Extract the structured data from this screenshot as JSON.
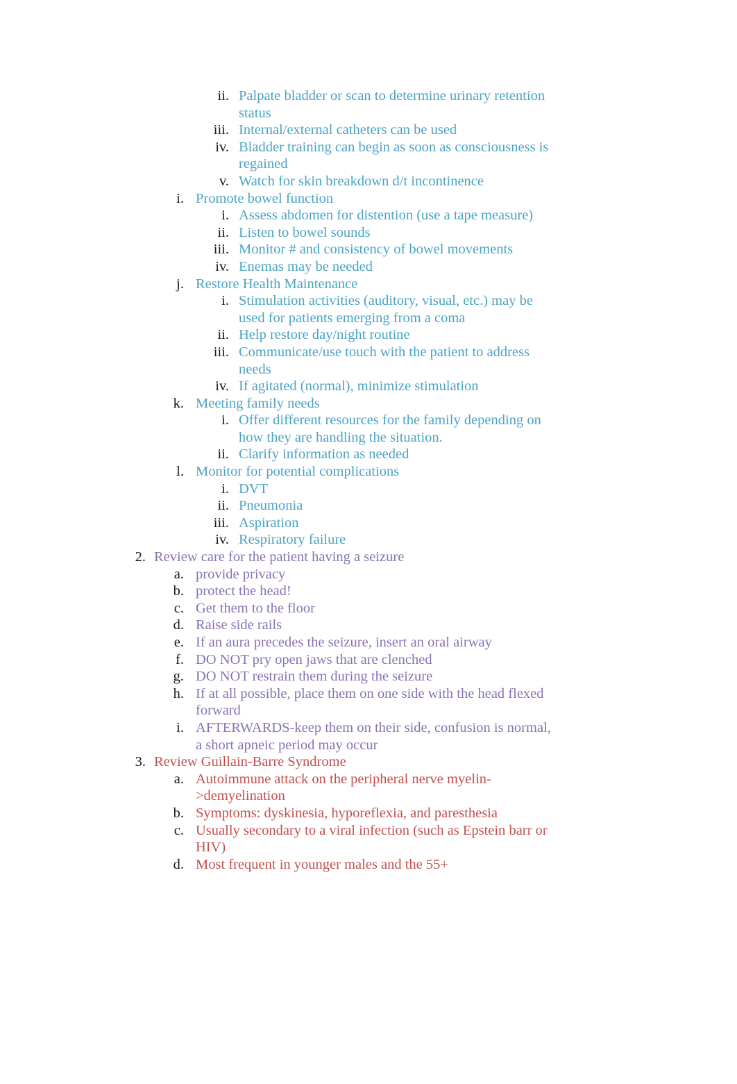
{
  "document": {
    "background_color": "#ffffff",
    "marker_color": "#1a1a1a",
    "colors": {
      "teal": "#4BA3C3",
      "purple": "#8A72B2",
      "red": "#C2504E"
    },
    "outline": [
      {
        "level": 3,
        "marker": "ii.",
        "color": "teal",
        "text": "Palpate bladder or scan to determine urinary retention status"
      },
      {
        "level": 3,
        "marker": "iii.",
        "color": "teal",
        "text": "Internal/external catheters can be used"
      },
      {
        "level": 3,
        "marker": "iv.",
        "color": "teal",
        "text": "Bladder training can begin as soon as consciousness is regained"
      },
      {
        "level": 3,
        "marker": "v.",
        "color": "teal",
        "text": "Watch for skin breakdown d/t incontinence"
      },
      {
        "level": 2,
        "marker": "i.",
        "color": "teal",
        "text": "Promote bowel function"
      },
      {
        "level": 3,
        "marker": "i.",
        "color": "teal",
        "text": "Assess abdomen for distention (use a tape measure)"
      },
      {
        "level": 3,
        "marker": "ii.",
        "color": "teal",
        "text": "Listen to bowel sounds"
      },
      {
        "level": 3,
        "marker": "iii.",
        "color": "teal",
        "text": "Monitor # and consistency of bowel movements"
      },
      {
        "level": 3,
        "marker": "iv.",
        "color": "teal",
        "text": "Enemas may be needed"
      },
      {
        "level": 2,
        "marker": "j.",
        "color": "teal",
        "text": "Restore Health Maintenance"
      },
      {
        "level": 3,
        "marker": "i.",
        "color": "teal",
        "text": "Stimulation activities (auditory, visual, etc.) may be used for patients emerging from a coma"
      },
      {
        "level": 3,
        "marker": "ii.",
        "color": "teal",
        "text": "Help restore day/night routine"
      },
      {
        "level": 3,
        "marker": "iii.",
        "color": "teal",
        "text": "Communicate/use touch with the patient to address needs"
      },
      {
        "level": 3,
        "marker": "iv.",
        "color": "teal",
        "text": "If agitated (normal), minimize stimulation"
      },
      {
        "level": 2,
        "marker": "k.",
        "color": "teal",
        "text": "Meeting family needs"
      },
      {
        "level": 3,
        "marker": "i.",
        "color": "teal",
        "text": "Offer different resources for the family depending on how they are handling the situation."
      },
      {
        "level": 3,
        "marker": "ii.",
        "color": "teal",
        "text": "Clarify information as needed"
      },
      {
        "level": 2,
        "marker": "l.",
        "color": "teal",
        "text": "Monitor for potential complications"
      },
      {
        "level": 3,
        "marker": "i.",
        "color": "teal",
        "text": "DVT"
      },
      {
        "level": 3,
        "marker": "ii.",
        "color": "teal",
        "text": "Pneumonia"
      },
      {
        "level": 3,
        "marker": "iii.",
        "color": "teal",
        "text": "Aspiration"
      },
      {
        "level": 3,
        "marker": "iv.",
        "color": "teal",
        "text": "Respiratory failure"
      },
      {
        "level": 1,
        "marker": "2.",
        "color": "purple",
        "text": "Review care for the patient having a seizure"
      },
      {
        "level": 2,
        "marker": "a.",
        "color": "purple",
        "text": "provide privacy"
      },
      {
        "level": 2,
        "marker": "b.",
        "color": "purple",
        "text": "protect the head!"
      },
      {
        "level": 2,
        "marker": "c.",
        "color": "purple",
        "text": "Get them to the floor"
      },
      {
        "level": 2,
        "marker": "d.",
        "color": "purple",
        "text": "Raise side rails"
      },
      {
        "level": 2,
        "marker": "e.",
        "color": "purple",
        "text": "If an aura precedes the seizure, insert an oral airway"
      },
      {
        "level": 2,
        "marker": "f.",
        "color": "purple",
        "text": "DO NOT pry open jaws that are clenched"
      },
      {
        "level": 2,
        "marker": "g.",
        "color": "purple",
        "text": "DO NOT restrain them during the seizure"
      },
      {
        "level": 2,
        "marker": "h.",
        "color": "purple",
        "text": "If at all possible, place them on one side with the head flexed forward"
      },
      {
        "level": 2,
        "marker": "i.",
        "color": "purple",
        "text": "AFTERWARDS-keep them on their side, confusion is normal, a short apneic period may occur"
      },
      {
        "level": 1,
        "marker": "3.",
        "color": "red",
        "text": "Review Guillain-Barre Syndrome"
      },
      {
        "level": 2,
        "marker": "a.",
        "color": "red",
        "text": "Autoimmune attack on the peripheral nerve myelin->demyelination"
      },
      {
        "level": 2,
        "marker": "b.",
        "color": "red",
        "text": "Symptoms: dyskinesia, hyporeflexia, and paresthesia"
      },
      {
        "level": 2,
        "marker": "c.",
        "color": "red",
        "text": "Usually secondary to a viral infection (such as Epstein barr or HIV)"
      },
      {
        "level": 2,
        "marker": "d.",
        "color": "red",
        "text": "Most frequent in younger males and the 55+"
      }
    ]
  }
}
